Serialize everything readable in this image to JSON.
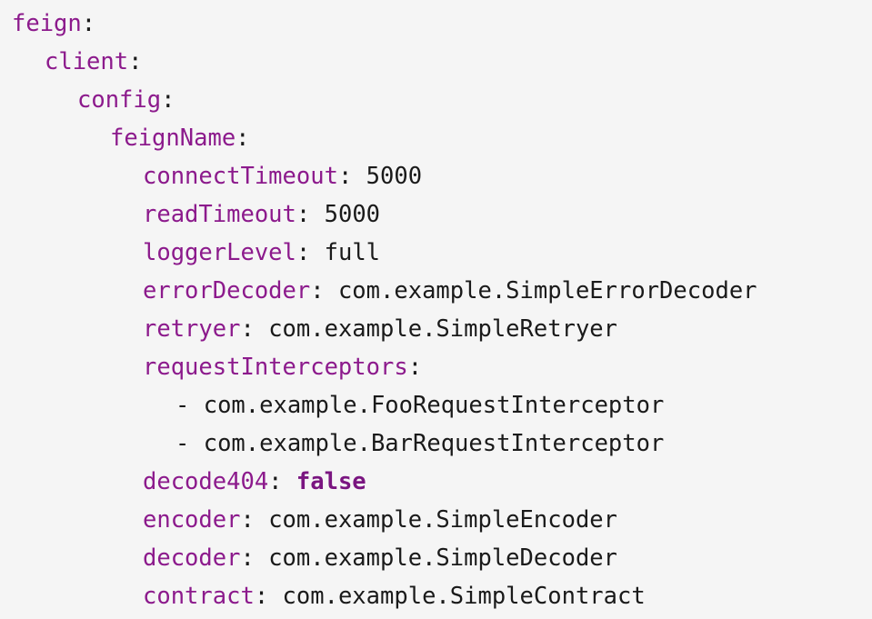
{
  "code": {
    "feign_key": "feign",
    "client_key": "client",
    "config_key": "config",
    "feign_name_key": "feignName",
    "colon": ":",
    "entries": {
      "connect_timeout": {
        "key": "connectTimeout",
        "value": "5000"
      },
      "read_timeout": {
        "key": "readTimeout",
        "value": "5000"
      },
      "logger_level": {
        "key": "loggerLevel",
        "value": "full"
      },
      "error_decoder": {
        "key": "errorDecoder",
        "value": "com.example.SimpleErrorDecoder"
      },
      "retryer": {
        "key": "retryer",
        "value": "com.example.SimpleRetryer"
      },
      "request_interceptors": {
        "key": "requestInterceptors",
        "items": [
          "com.example.FooRequestInterceptor",
          "com.example.BarRequestInterceptor"
        ]
      },
      "decode404": {
        "key": "decode404",
        "value": "false"
      },
      "encoder": {
        "key": "encoder",
        "value": "com.example.SimpleEncoder"
      },
      "decoder": {
        "key": "decoder",
        "value": "com.example.SimpleDecoder"
      },
      "contract": {
        "key": "contract",
        "value": "com.example.SimpleContract"
      }
    },
    "list_dash": "-"
  },
  "colors": {
    "background": "#f5f5f5",
    "key": "#8c1a8c",
    "value": "#1a1a1a",
    "boolean": "#7a1580"
  }
}
